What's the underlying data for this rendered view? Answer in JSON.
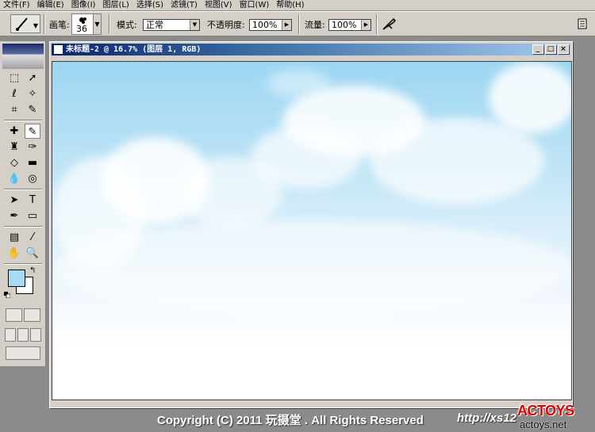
{
  "menu": [
    "文件(F)",
    "编辑(E)",
    "图像(I)",
    "图层(L)",
    "选择(S)",
    "滤镜(T)",
    "视图(V)",
    "窗口(W)",
    "帮助(H)"
  ],
  "options": {
    "brush_label": "画笔:",
    "brush_size": "36",
    "mode_label": "模式:",
    "mode_value": "正常",
    "opacity_label": "不透明度:",
    "opacity_value": "100%",
    "flow_label": "流量:",
    "flow_value": "100%"
  },
  "document": {
    "title": "未标题-2 @ 16.7% (图层 1, RGB)",
    "canvas_description": "sky"
  },
  "colors": {
    "foreground": "#a6dbf5",
    "background": "#ffffff"
  },
  "footer": {
    "copyright": "Copyright (C) 2011  玩摄堂 . All Rights Reserved",
    "url": "http://xs12",
    "brand": "ACTOYS",
    "brand_url": "actoys.net"
  }
}
